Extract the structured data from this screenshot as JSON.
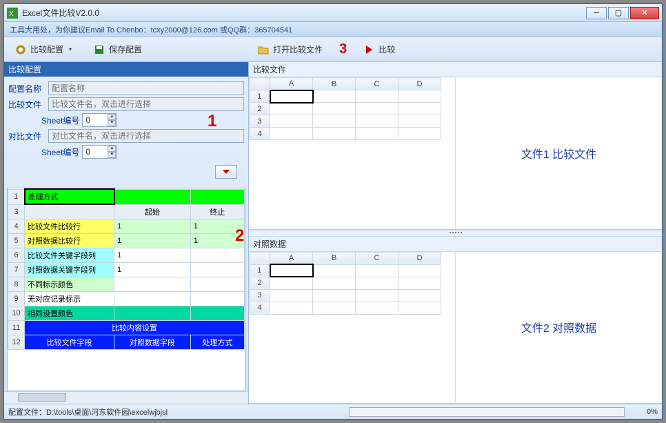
{
  "window": {
    "title": "Excel文件比较V2.0.0",
    "info": "工具大用处，为你建议Email To Chenbo：tcxy2000@126.com  或QQ群：365704541"
  },
  "toolbar": {
    "config_btn": "比较配置",
    "save_btn": "保存配置",
    "open_btn": "打开比较文件",
    "compare_btn": "比较"
  },
  "markers": {
    "m1": "1",
    "m2": "2",
    "m3": "3"
  },
  "left_panel": {
    "title": "比较配置",
    "config_name_label": "配置名称",
    "config_name_placeholder": "配置名称",
    "compare_file_label": "比较文件",
    "compare_file_placeholder": "比较文件名，双击进行选择",
    "sheet_label": "Sheet编号",
    "sheet1_value": "0",
    "contrast_file_label": "对比文件",
    "contrast_file_placeholder": "对比文件名，双击进行选择",
    "sheet2_value": "0",
    "grid": {
      "cols": [
        "",
        "起始",
        "终止"
      ],
      "rows": [
        {
          "n": "1",
          "cells": [
            "处理方式",
            "",
            ""
          ],
          "cls": "row-green",
          "sel": true
        },
        {
          "n": "3",
          "cells": [
            "",
            "起始",
            "终止"
          ],
          "cls": "hdr-row"
        },
        {
          "n": "4",
          "cells": [
            "比较文件比较行",
            "1",
            "1"
          ],
          "cls": "row-yellow"
        },
        {
          "n": "5",
          "cells": [
            "对照数据比较行",
            "1",
            "1"
          ],
          "cls": "row-yellow"
        },
        {
          "n": "6",
          "cells": [
            "比较文件关键字段列",
            "1",
            ""
          ],
          "cls": "row-cyan"
        },
        {
          "n": "7",
          "cells": [
            "对照数据关键字段列",
            "1",
            ""
          ],
          "cls": "row-cyan"
        },
        {
          "n": "8",
          "cells": [
            "不同标示颜色",
            "",
            ""
          ],
          "cls": "row-lightgreen"
        },
        {
          "n": "9",
          "cells": [
            "无对应记录标示",
            "",
            ""
          ],
          "cls": ""
        },
        {
          "n": "10",
          "cells": [
            "相同设置颜色",
            "",
            ""
          ],
          "cls": "row-teal"
        },
        {
          "n": "11",
          "cells": [
            "比较内容设置",
            "",
            ""
          ],
          "cls": "row-blue center",
          "span": 3
        },
        {
          "n": "12",
          "cells": [
            "比较文件字段",
            "对照数据字段",
            "处理方式"
          ],
          "cls": "row-blue center"
        }
      ]
    }
  },
  "right": {
    "top_title": "比较文件",
    "top_label": "文件1 比较文件",
    "bottom_title": "对照数据",
    "bottom_label": "文件2 对照数据",
    "cols": [
      "A",
      "B",
      "C",
      "D"
    ],
    "rows": [
      "1",
      "2",
      "3",
      "4"
    ]
  },
  "status": {
    "path": "配置文件：D:\\tools\\桌面\\河东软件园\\excelwjbjsl",
    "pct": "0%"
  },
  "chart_data": null
}
